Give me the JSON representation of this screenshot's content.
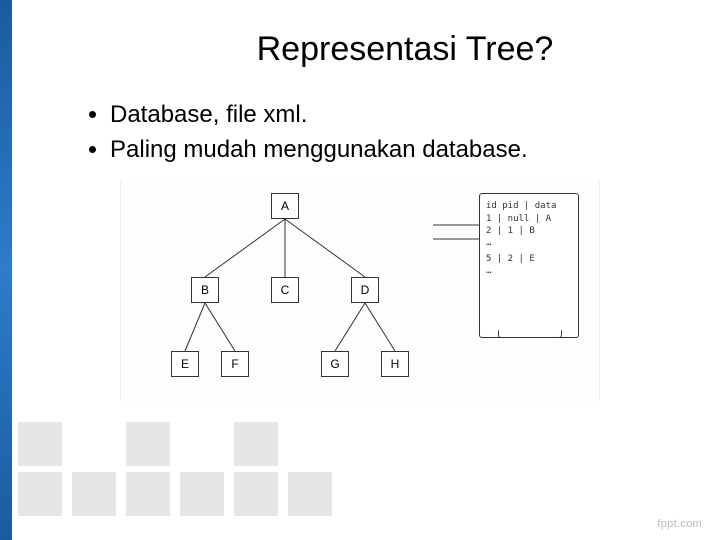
{
  "title": "Representasi Tree?",
  "bullets": [
    "Database, file xml.",
    "Paling mudah menggunakan database."
  ],
  "tree": {
    "nodes": {
      "A": {
        "label": "A"
      },
      "B": {
        "label": "B"
      },
      "C": {
        "label": "C"
      },
      "D": {
        "label": "D"
      },
      "E": {
        "label": "E"
      },
      "F": {
        "label": "F"
      },
      "G": {
        "label": "G"
      },
      "H": {
        "label": "H"
      }
    },
    "edges": [
      [
        "A",
        "B"
      ],
      [
        "A",
        "C"
      ],
      [
        "A",
        "D"
      ],
      [
        "B",
        "E"
      ],
      [
        "B",
        "F"
      ],
      [
        "D",
        "G"
      ],
      [
        "D",
        "H"
      ]
    ]
  },
  "db_table": {
    "header": "id  pid | data",
    "rows": [
      "1 | null | A",
      "2 |   1  | B",
      "…",
      "5 |   2  | E",
      "…"
    ]
  },
  "watermark": "fppt.com"
}
